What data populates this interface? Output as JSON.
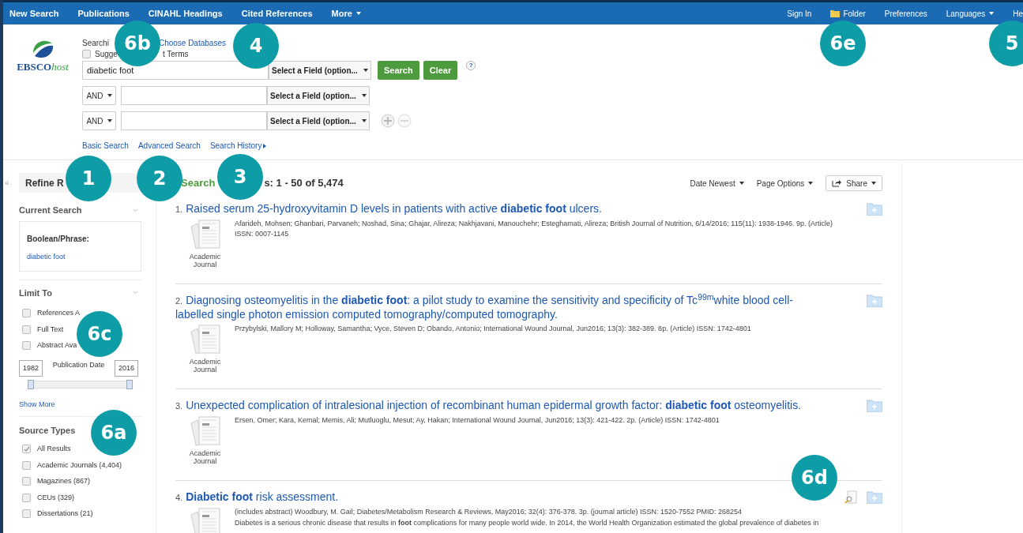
{
  "top_nav": {
    "left": [
      {
        "label": "New Search",
        "dropdown": false
      },
      {
        "label": "Publications",
        "dropdown": false
      },
      {
        "label": "CINAHL Headings",
        "dropdown": false
      },
      {
        "label": "Cited References",
        "dropdown": false
      },
      {
        "label": "More",
        "dropdown": true
      }
    ],
    "right": [
      {
        "label": "Sign In",
        "kind": "link",
        "dropdown": false
      },
      {
        "label": "Folder",
        "kind": "folder",
        "dropdown": false
      },
      {
        "label": "Preferences",
        "kind": "link",
        "dropdown": false
      },
      {
        "label": "Languages",
        "kind": "link",
        "dropdown": true
      },
      {
        "label": "He",
        "kind": "link",
        "dropdown": false
      }
    ]
  },
  "logo": {
    "brand": "EBSCO",
    "suffix": "host"
  },
  "search": {
    "searching_label": "Searchi",
    "choose_databases": "Choose Databases",
    "suggest": {
      "label_start": "Sugge",
      "label_end": "t Terms",
      "checked": false
    },
    "rows": [
      {
        "value": "diabetic foot",
        "field": "Select a Field (option..."
      },
      {
        "operator": "AND",
        "field": "Select a Field (option..."
      },
      {
        "operator": "AND",
        "field": "Select a Field (option..."
      }
    ],
    "buttons": [
      "Search",
      "Clear"
    ],
    "help": "?",
    "links": [
      {
        "label": "Basic Search",
        "arrow": false
      },
      {
        "label": "Advanced Search",
        "arrow": false
      },
      {
        "label": "Search History",
        "arrow": true
      }
    ]
  },
  "sidebar": {
    "collapse": "«",
    "title": "Refine R",
    "current_search": {
      "heading": "Current Search",
      "label": "Boolean/Phrase:",
      "query": "diabetic foot"
    },
    "limit_to": {
      "heading": "Limit To",
      "options": [
        {
          "label": "References A",
          "checked": false
        },
        {
          "label": "Full Text",
          "checked": false
        },
        {
          "label": "Abstract Ava",
          "checked": false
        }
      ],
      "date": {
        "from": "1982",
        "label": "Publication Date",
        "to": "2016",
        "handles": [
          {
            "level": 0
          },
          {
            "level": 1
          }
        ]
      },
      "show_more": "Show More"
    },
    "source_types": {
      "heading": "Source Types",
      "options": [
        {
          "label": "All Results",
          "checked": true
        },
        {
          "label": "Academic Journals (4,404)",
          "checked": false
        },
        {
          "label": "Magazines (867)",
          "checked": false
        },
        {
          "label": "CEUs (329)",
          "checked": false
        },
        {
          "label": "Dissertations (21)",
          "checked": false
        }
      ]
    }
  },
  "results": {
    "heading_start": "Search",
    "heading_end": "s: 1 - 50 of 5,474",
    "sort": "Date Newest",
    "page_options": "Page Options",
    "share": "Share",
    "items": [
      {
        "number": "1.",
        "title": "Raised serum 25-hydroxyvitamin D levels in patients with active **diabetic foot** ulcers.",
        "type": "Academic Journal",
        "meta": "Afarideh, Mohsen; Ghanbari, Parvaneh; Noshad, Sina; Ghajar, Alireza; Nakhjavani, Manouchehr; Esteghamati, Alireza; British Journal of Nutrition, 6/14/2016; 115(11): 1938-1946. 9p. (Article) ISSN: 0007-1145",
        "preview": false
      },
      {
        "number": "2.",
        "title": "Diagnosing osteomyelitis in the **diabetic foot**: a pilot study to examine the sensitivity and specificity of Tc$^{99m}$white blood cell-labelled single photon emission computed tomography/computed tomography.",
        "type": "Academic Journal",
        "meta": "Przybylski, Mallory M; Holloway, Samantha; Vyce, Steven D; Obando, Antonio; International Wound Journal, Jun2016; 13(3): 382-389. 8p. (Article) ISSN: 1742-4801",
        "preview": false
      },
      {
        "number": "3.",
        "title": "Unexpected complication of intralesional injection of recombinant human epidermal growth factor: **diabetic foot** osteomyelitis.",
        "type": "Academic Journal",
        "meta": "Ersen, Omer; Kara, Kemal; Memis, Ali; Mutluoglu, Mesut; Ay, Hakan; International Wound Journal, Jun2016; 13(3): 421-422. 2p. (Article) ISSN: 1742-4801",
        "preview": false
      },
      {
        "number": "4.",
        "title": "**Diabetic foot** risk assessment.",
        "meta": "(includes abstract) Woodbury, M. Gail; Diabetes/Metabolism Research & Reviews, May2016; 32(4): 376-378. 3p. (journal article) ISSN: 1520-7552 PMID: 268254",
        "abstract": "Diabetes is a serious chronic disease that results in **foot** complications for many people world wide. In 2014, the World Health Organization estimated the global prevalence of diabetes in",
        "preview": true
      }
    ]
  },
  "annotations": [
    {
      "label": "6b"
    },
    {
      "label": "4"
    },
    {
      "label": "6e"
    },
    {
      "label": "5"
    },
    {
      "label": "1"
    },
    {
      "label": "2"
    },
    {
      "label": "3"
    },
    {
      "label": "6c"
    },
    {
      "label": "6a"
    },
    {
      "label": "6d"
    }
  ]
}
